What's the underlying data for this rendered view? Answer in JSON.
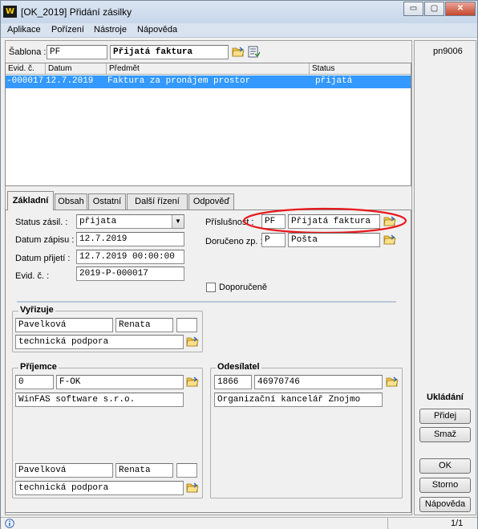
{
  "window": {
    "title": "[OK_2019] Přidání zásilky",
    "logo": "W",
    "controls": {
      "minimize": "▭",
      "maximize": "▢",
      "close": "✕"
    }
  },
  "menu": [
    "Aplikace",
    "Pořízení",
    "Nástroje",
    "Nápověda"
  ],
  "template": {
    "label": "Šablona :",
    "code": "PF",
    "name": "Přijatá faktura"
  },
  "user_code": "pn9006",
  "table": {
    "columns": [
      "Evid. č.",
      "Datum",
      "Předmět",
      "Status"
    ],
    "rows": [
      {
        "evid": "-000017",
        "date": "12.7.2019",
        "subject": "Faktura za pronájem prostor",
        "status": "přijatá"
      }
    ]
  },
  "tabs": [
    "Základní",
    "Obsah",
    "Ostatní",
    "Další řízení",
    "Odpověď"
  ],
  "form": {
    "status_label": "Status zásil. :",
    "status_value": "přijata",
    "date_entry_label": "Datum zápisu :",
    "date_entry_value": "12.7.2019",
    "date_received_label": "Datum přijetí :",
    "date_received_value": "12.7.2019 00:00:00",
    "evid_label": "Evid. č. :",
    "evid_value": "2019-P-000017",
    "affiliation_label": "Příslušnost :",
    "affiliation_code": "PF",
    "affiliation_name": "Přijatá faktura",
    "delivered_label": "Doručeno zp. :",
    "delivered_code": "P",
    "delivered_name": "Pošta",
    "recommended_label": "Doporučeně"
  },
  "handler": {
    "title": "Vyřizuje",
    "surname": "Pavelková",
    "firstname": "Renata",
    "extra": "",
    "department": "technická podpora"
  },
  "recipient": {
    "title": "Příjemce",
    "code": "0",
    "short": "F-OK",
    "company": "WinFAS software s.r.o.",
    "surname": "Pavelková",
    "firstname": "Renata",
    "extra": "",
    "department": "technická podpora"
  },
  "sender": {
    "title": "Odesílatel",
    "code": "1866",
    "ico": "46970746",
    "name": "Organizační kancelář Znojmo"
  },
  "save": {
    "title": "Ukládání",
    "add": "Přidej",
    "delete": "Smaž",
    "ok": "OK",
    "cancel": "Storno",
    "help": "Nápověda"
  },
  "status_bar": {
    "pager": "1/1",
    "info_icon": "info-icon"
  },
  "colors": {
    "selection": "#3399ff",
    "annotation": "#e8191d"
  }
}
